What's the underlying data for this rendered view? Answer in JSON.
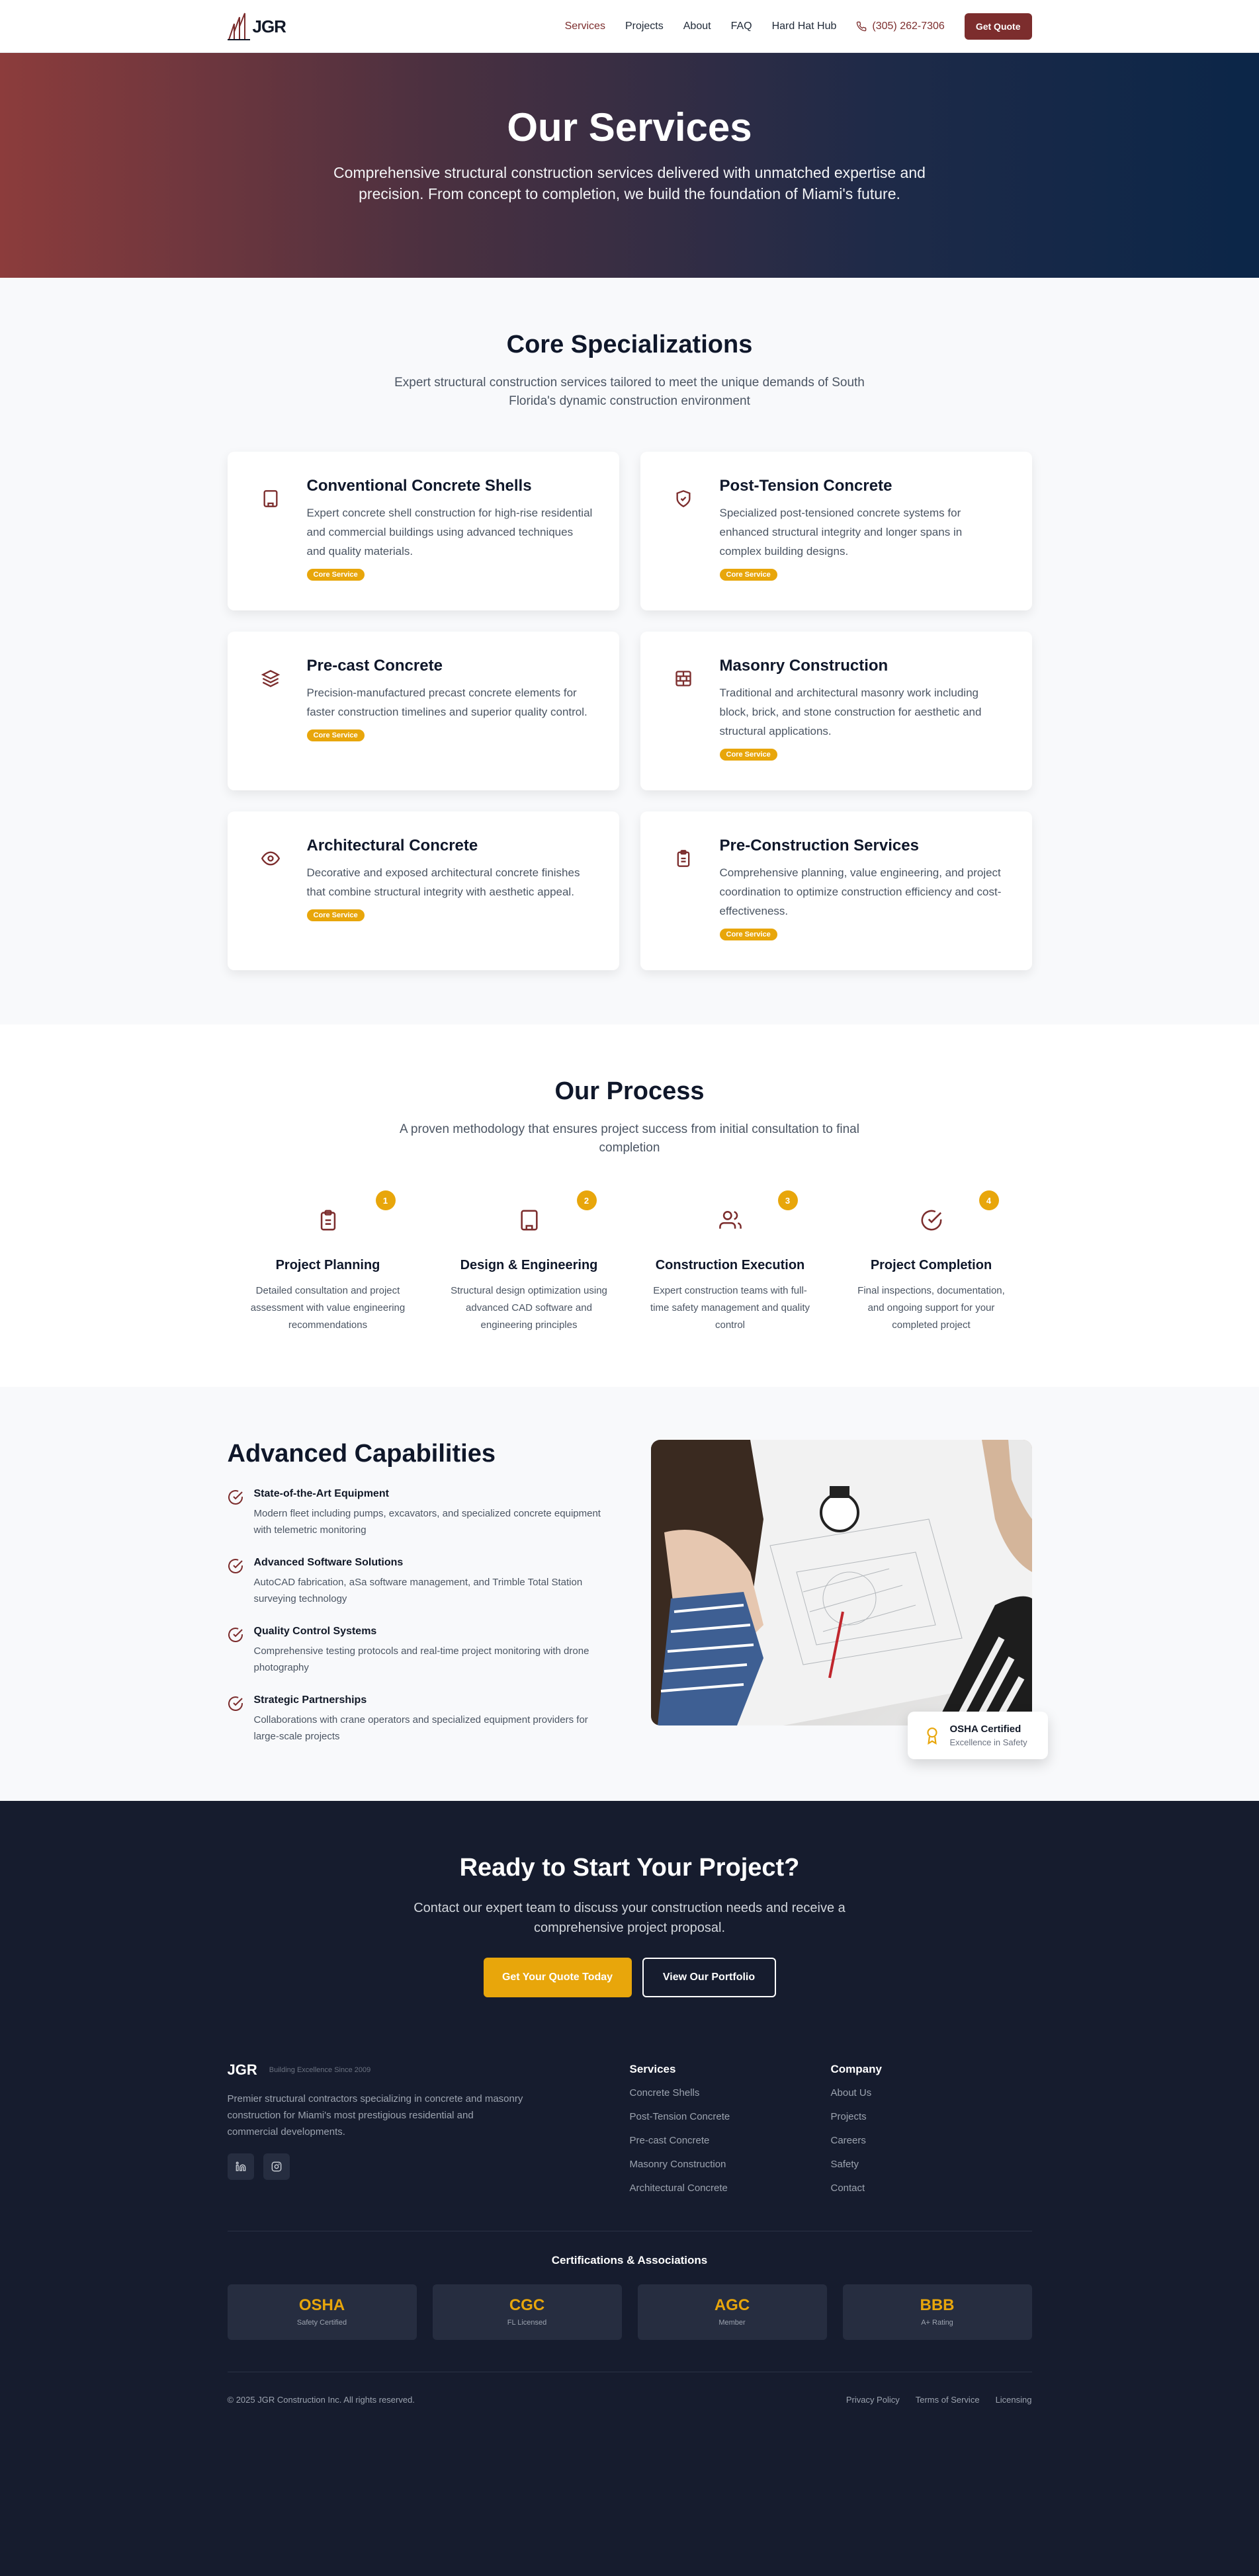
{
  "nav": {
    "logo_text": "JGR",
    "links": [
      "Services",
      "Projects",
      "About",
      "FAQ",
      "Hard Hat Hub"
    ],
    "phone": "(305) 262-7306",
    "quote_button": "Get Quote"
  },
  "hero": {
    "title": "Our Services",
    "subtitle": "Comprehensive structural construction services delivered with unmatched expertise and precision. From concept to completion, we build the foundation of Miami's future."
  },
  "specializations": {
    "title": "Core Specializations",
    "subtitle": "Expert structural construction services tailored to meet the unique demands of South Florida's dynamic construction environment",
    "cards": [
      {
        "icon": "building-icon",
        "title": "Conventional Concrete Shells",
        "desc": "Expert concrete shell construction for high-rise residential and commercial buildings using advanced techniques and quality materials.",
        "badge": "Core Service"
      },
      {
        "icon": "shield-icon",
        "title": "Post-Tension Concrete",
        "desc": "Specialized post-tensioned concrete systems for enhanced structural integrity and longer spans in complex building designs.",
        "badge": "Core Service"
      },
      {
        "icon": "layers-icon",
        "title": "Pre-cast Concrete",
        "desc": "Precision-manufactured precast concrete elements for faster construction timelines and superior quality control.",
        "badge": "Core Service"
      },
      {
        "icon": "brick-icon",
        "title": "Masonry Construction",
        "desc": "Traditional and architectural masonry work including block, brick, and stone construction for aesthetic and structural applications.",
        "badge": "Core Service"
      },
      {
        "icon": "eye-icon",
        "title": "Architectural Concrete",
        "desc": "Decorative and exposed architectural concrete finishes that combine structural integrity with aesthetic appeal.",
        "badge": "Core Service"
      },
      {
        "icon": "clipboard-icon",
        "title": "Pre-Construction Services",
        "desc": "Comprehensive planning, value engineering, and project coordination to optimize construction efficiency and cost-effectiveness.",
        "badge": "Core Service"
      }
    ]
  },
  "process": {
    "title": "Our Process",
    "subtitle": "A proven methodology that ensures project success from initial consultation to final completion",
    "steps": [
      {
        "num": "1",
        "icon": "clipboard-icon",
        "title": "Project Planning",
        "desc": "Detailed consultation and project assessment with value engineering recommendations"
      },
      {
        "num": "2",
        "icon": "building-icon",
        "title": "Design & Engineering",
        "desc": "Structural design optimization using advanced CAD software and engineering principles"
      },
      {
        "num": "3",
        "icon": "users-icon",
        "title": "Construction Execution",
        "desc": "Expert construction teams with full-time safety management and quality control"
      },
      {
        "num": "4",
        "icon": "check-circle-icon",
        "title": "Project Completion",
        "desc": "Final inspections, documentation, and ongoing support for your completed project"
      }
    ]
  },
  "capabilities": {
    "title": "Advanced Capabilities",
    "items": [
      {
        "title": "State-of-the-Art Equipment",
        "desc": "Modern fleet including pumps, excavators, and specialized concrete equipment with telemetric monitoring"
      },
      {
        "title": "Advanced Software Solutions",
        "desc": "AutoCAD fabrication, aSa software management, and Trimble Total Station surveying technology"
      },
      {
        "title": "Quality Control Systems",
        "desc": "Comprehensive testing protocols and real-time project monitoring with drone photography"
      },
      {
        "title": "Strategic Partnerships",
        "desc": "Collaborations with crane operators and specialized equipment providers for large-scale projects"
      }
    ],
    "cert_card": {
      "title": "OSHA Certified",
      "subtitle": "Excellence in Safety"
    }
  },
  "cta": {
    "title": "Ready to Start Your Project?",
    "subtitle": "Contact our expert team to discuss your construction needs and receive a comprehensive project proposal.",
    "primary_button": "Get Your Quote Today",
    "secondary_button": "View Our Portfolio"
  },
  "footer": {
    "brand": "JGR",
    "since": "Building Excellence Since 2009",
    "desc": "Premier structural contractors specializing in concrete and masonry construction for Miami's most prestigious residential and commercial developments.",
    "services_title": "Services",
    "services": [
      "Concrete Shells",
      "Post-Tension Concrete",
      "Pre-cast Concrete",
      "Masonry Construction",
      "Architectural Concrete"
    ],
    "company_title": "Company",
    "company": [
      "About Us",
      "Projects",
      "Careers",
      "Safety",
      "Contact"
    ],
    "certs_title": "Certifications & Associations",
    "certs": [
      {
        "name": "OSHA",
        "desc": "Safety Certified"
      },
      {
        "name": "CGC",
        "desc": "FL Licensed"
      },
      {
        "name": "AGC",
        "desc": "Member"
      },
      {
        "name": "BBB",
        "desc": "A+ Rating"
      }
    ],
    "copyright": "© 2025 JGR Construction Inc. All rights reserved.",
    "legal": [
      "Privacy Policy",
      "Terms of Service",
      "Licensing"
    ]
  },
  "colors": {
    "brand": "#7c2d2d",
    "accent": "#e8a60b",
    "dark": "#161c2e"
  }
}
